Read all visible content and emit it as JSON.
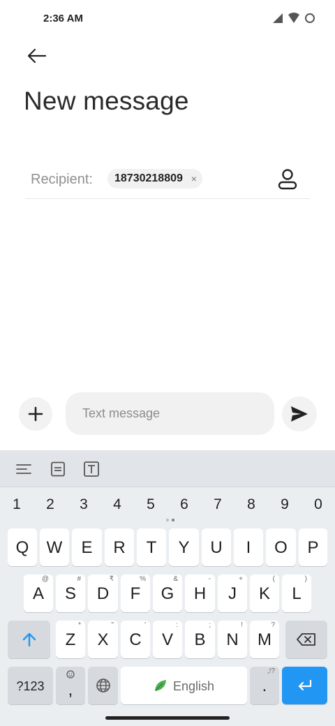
{
  "status_bar": {
    "time": "2:36 AM",
    "icons": [
      "signal-icon",
      "wifi-icon",
      "battery-icon"
    ]
  },
  "header": {
    "back_icon": "arrow-left-icon",
    "title": "New message"
  },
  "recipient": {
    "label": "Recipient:",
    "chip_number": "18730218809",
    "chip_close": "×",
    "contact_icon": "person-icon"
  },
  "compose": {
    "add_icon": "plus-icon",
    "placeholder": "Text message",
    "value": "",
    "send_icon": "send-icon"
  },
  "keyboard": {
    "toolbar_icons": [
      "align-left-icon",
      "clipboard-icon",
      "text-format-icon"
    ],
    "numbers": [
      "1",
      "2",
      "3",
      "4",
      "5",
      "6",
      "7",
      "8",
      "9",
      "0"
    ],
    "row1": [
      "Q",
      "W",
      "E",
      "R",
      "T",
      "Y",
      "U",
      "I",
      "O",
      "P"
    ],
    "row2": [
      {
        "key": "A",
        "hint": "@"
      },
      {
        "key": "S",
        "hint": "#"
      },
      {
        "key": "D",
        "hint": "₹"
      },
      {
        "key": "F",
        "hint": "%"
      },
      {
        "key": "G",
        "hint": "&"
      },
      {
        "key": "H",
        "hint": "-"
      },
      {
        "key": "J",
        "hint": "+"
      },
      {
        "key": "K",
        "hint": "("
      },
      {
        "key": "L",
        "hint": ")"
      }
    ],
    "row3": [
      {
        "key": "Z",
        "hint": "*"
      },
      {
        "key": "X",
        "hint": "\""
      },
      {
        "key": "C",
        "hint": "'"
      },
      {
        "key": "V",
        "hint": ":"
      },
      {
        "key": "B",
        "hint": ";"
      },
      {
        "key": "N",
        "hint": "!"
      },
      {
        "key": "M",
        "hint": "?"
      }
    ],
    "symbols_label": "?123",
    "comma_label": ",",
    "space_label": "English",
    "period_label": ".",
    "period_hint": ",!?",
    "accent_color": "#2196f3"
  }
}
